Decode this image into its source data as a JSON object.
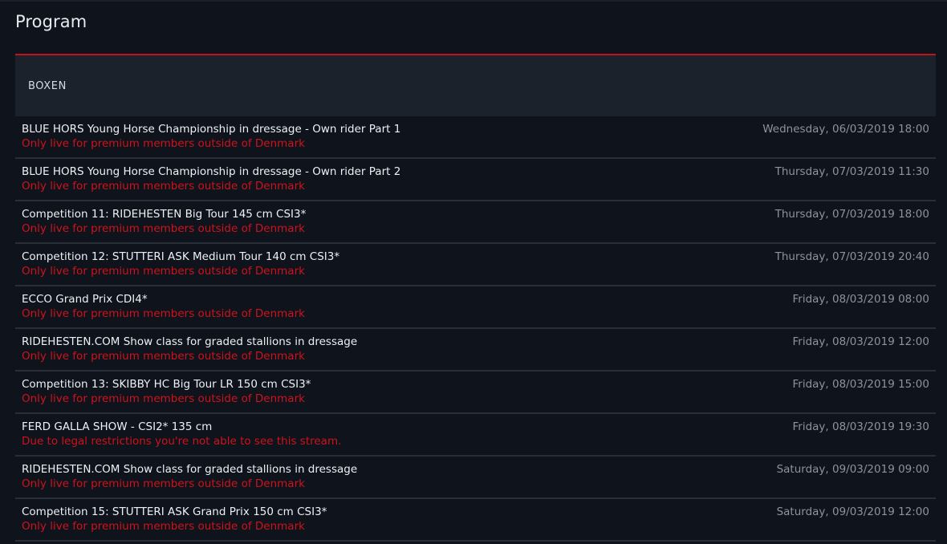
{
  "page": {
    "title": "Program"
  },
  "section": {
    "label": "BOXEN"
  },
  "colors": {
    "background": "#0e131c",
    "header_bg": "#1c222c",
    "accent_red": "#c4121b",
    "notice_red": "#d0121b",
    "date_gray": "#8d939c"
  },
  "items": [
    {
      "title": "BLUE HORS Young Horse Championship in dressage - Own rider Part 1",
      "notice": "Only live for premium members outside of Denmark",
      "datetime": "Wednesday, 06/03/2019 18:00"
    },
    {
      "title": "BLUE HORS Young Horse Championship in dressage - Own rider Part 2",
      "notice": "Only live for premium members outside of Denmark",
      "datetime": "Thursday, 07/03/2019 11:30"
    },
    {
      "title": "Competition 11: RIDEHESTEN Big Tour 145 cm CSI3*",
      "notice": "Only live for premium members outside of Denmark",
      "datetime": "Thursday, 07/03/2019 18:00"
    },
    {
      "title": "Competition 12: STUTTERI ASK Medium Tour 140 cm CSI3*",
      "notice": "Only live for premium members outside of Denmark",
      "datetime": "Thursday, 07/03/2019 20:40"
    },
    {
      "title": "ECCO Grand Prix CDI4*",
      "notice": "Only live for premium members outside of Denmark",
      "datetime": "Friday, 08/03/2019 08:00"
    },
    {
      "title": "RIDEHESTEN.COM Show class for graded stallions in dressage",
      "notice": "Only live for premium members outside of Denmark",
      "datetime": "Friday, 08/03/2019 12:00"
    },
    {
      "title": "Competition 13: SKIBBY HC Big Tour LR 150 cm CSI3*",
      "notice": "Only live for premium members outside of Denmark",
      "datetime": "Friday, 08/03/2019 15:00"
    },
    {
      "title": "FERD GALLA SHOW - CSI2* 135 cm",
      "notice": "Due to legal restrictions you're not able to see this stream.",
      "datetime": "Friday, 08/03/2019 19:30"
    },
    {
      "title": "RIDEHESTEN.COM Show class for graded stallions in dressage",
      "notice": "Only live for premium members outside of Denmark",
      "datetime": "Saturday, 09/03/2019 09:00"
    },
    {
      "title": "Competition 15: STUTTERI ASK Grand Prix 150 cm CSI3*",
      "notice": "Only live for premium members outside of Denmark",
      "datetime": "Saturday, 09/03/2019 12:00"
    }
  ]
}
